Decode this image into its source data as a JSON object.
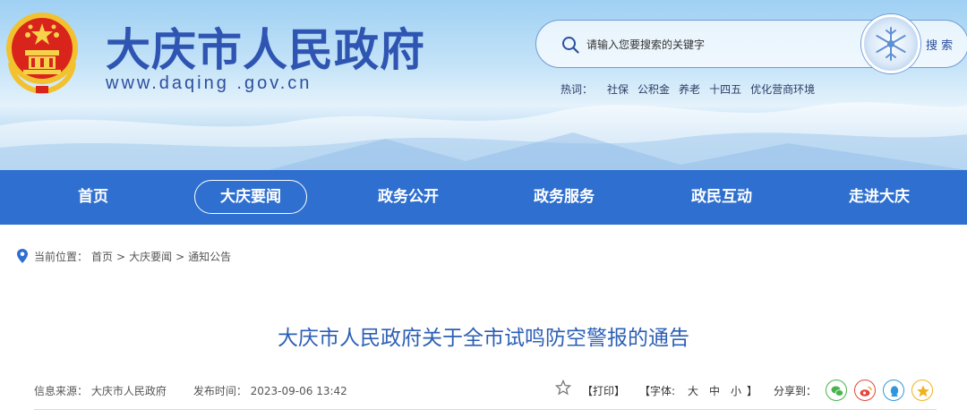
{
  "header": {
    "site_title": "大庆市人民政府",
    "site_url": "www.daqing .gov.cn",
    "search": {
      "placeholder": "请输入您要搜索的关键字",
      "button_label": "搜 索"
    },
    "hotwords": {
      "label": "热词：",
      "items": [
        "社保",
        "公积金",
        "养老",
        "十四五",
        "优化营商环境"
      ]
    }
  },
  "nav": {
    "items": [
      {
        "label": "首页"
      },
      {
        "label": "大庆要闻"
      },
      {
        "label": "政务公开"
      },
      {
        "label": "政务服务"
      },
      {
        "label": "政民互动"
      },
      {
        "label": "走进大庆"
      }
    ],
    "active": "大庆要闻"
  },
  "breadcrumb": {
    "label": "当前位置：",
    "items": [
      "首页",
      "大庆要闻",
      "通知公告"
    ],
    "separator": ">"
  },
  "article": {
    "title": "大庆市人民政府关于全市试鸣防空警报的通告",
    "source": "信息来源： 大庆市人民政府",
    "published": "发布时间： 2023-09-06 13:42",
    "print_label": "【打印】",
    "font_label": "【字体:",
    "font_sizes": [
      "大",
      "中",
      "小"
    ],
    "font_close": "】",
    "share_label": "分享到："
  },
  "share_icons": [
    "wechat-icon",
    "weibo-icon",
    "qq-icon",
    "qzone-icon"
  ],
  "colors": {
    "nav_bg": "#2e6fcf",
    "brand_blue": "#2f55b2",
    "title_blue": "#2c5fb5",
    "wechat": "#47b34b",
    "weibo": "#e2463d",
    "qq": "#2f96e0",
    "qzone": "#f0b21e"
  }
}
